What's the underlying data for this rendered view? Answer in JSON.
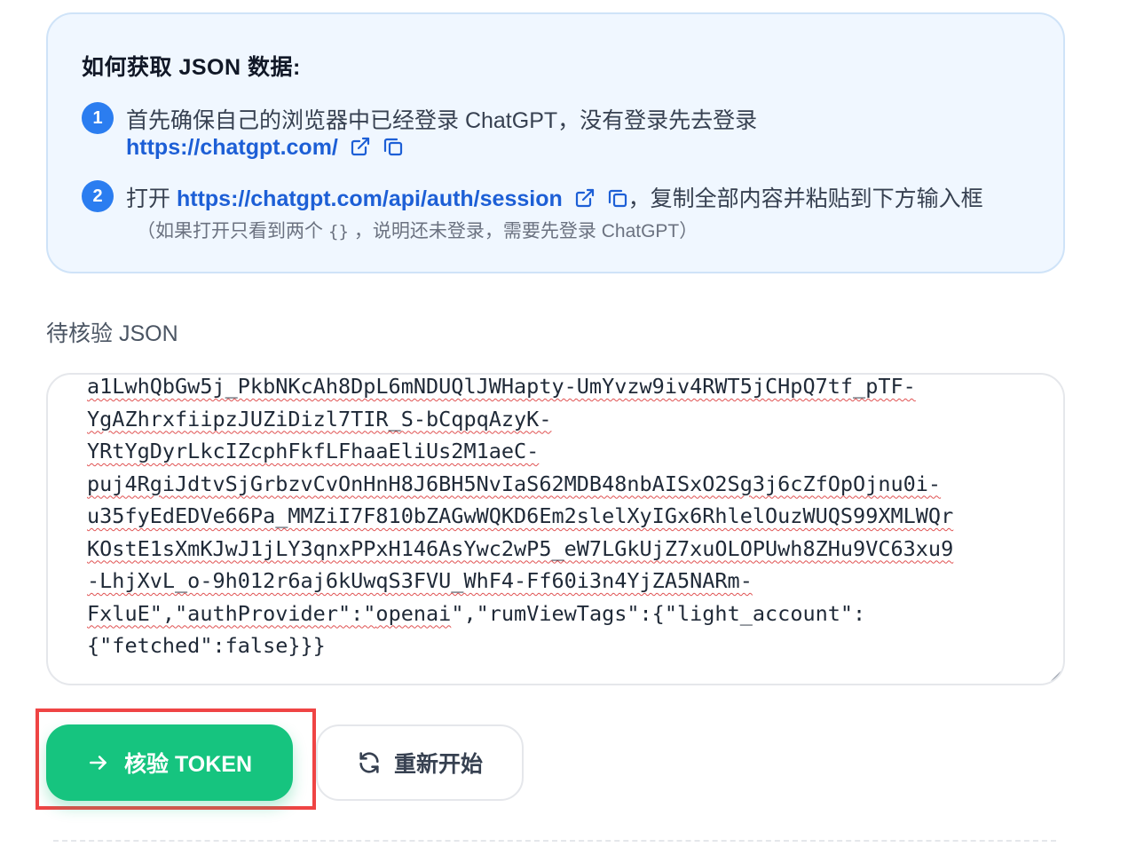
{
  "instructions": {
    "title": "如何获取 JSON 数据:",
    "step1": {
      "number": "1",
      "text": "首先确保自己的浏览器中已经登录 ChatGPT，没有登录先去登录",
      "link": "https://chatgpt.com/"
    },
    "step2": {
      "number": "2",
      "prefix": "打开",
      "link": "https://chatgpt.com/api/auth/session",
      "suffix": "，复制全部内容并粘贴到下方输入框",
      "note_before": "（如果打开只看到两个",
      "note_braces": "{}",
      "note_after": "，说明还未登录，需要先登录 ChatGPT）"
    }
  },
  "json_field": {
    "label": "待核验 JSON",
    "lines": [
      "a1LwhQbGw5j_PkbNKcAh8DpL6mNDUQlJWHapty-UmYvzw9iv4RWT5jCHpQ7tf_pTF-",
      "YgAZhrxfiipzJUZiDizl7TIR_S-bCqpqAzyK-",
      "YRtYgDyrLkcIZcphFkfLFhaaEliUs2M1aeC-",
      "puj4RgiJdtvSjGrbzvCvOnHnH8J6BH5NvIaS62MDB48nbAISxO2Sg3j6cZfOpOjnu0i-",
      "u35fyEdEDVe66Pa_MMZiI7F810bZAGwWQKD6Em2slelXyIGx6RhlelOuzWUQS99XMLWQr",
      "KOstE1sXmKJwJ1jLY3qnxPPxH146AsYwc2wP5_eW7LGkUjZ7xuOLOPUwh8ZHu9VC63xu9",
      "-LhjXvL_o-9h012r6aj6kUwqS3FVU_WhF4-Ff60i3n4YjZA5NARm-",
      "FxluE\",\"authProvider\":\"openai\",\"rumViewTags\":{\"light_account\":",
      "{\"fetched\":false}}}"
    ],
    "line8_parts": [
      "FxluE\",\"authProvider\":\"",
      "openai",
      "\",\"rumViewTags\":{\"light_account\":"
    ]
  },
  "actions": {
    "verify_label": "核验 TOKEN",
    "restart_label": "重新开始"
  },
  "colors": {
    "accent_blue": "#2b7df0",
    "link_blue": "#1d5fd6",
    "verify_green": "#16c47f",
    "highlight_red": "#ef4444",
    "card_bg": "#f0f7ff"
  },
  "icons": {
    "external_link": "external-link-icon",
    "copy": "copy-icon",
    "arrow_right": "arrow-right-icon",
    "refresh": "refresh-icon"
  }
}
